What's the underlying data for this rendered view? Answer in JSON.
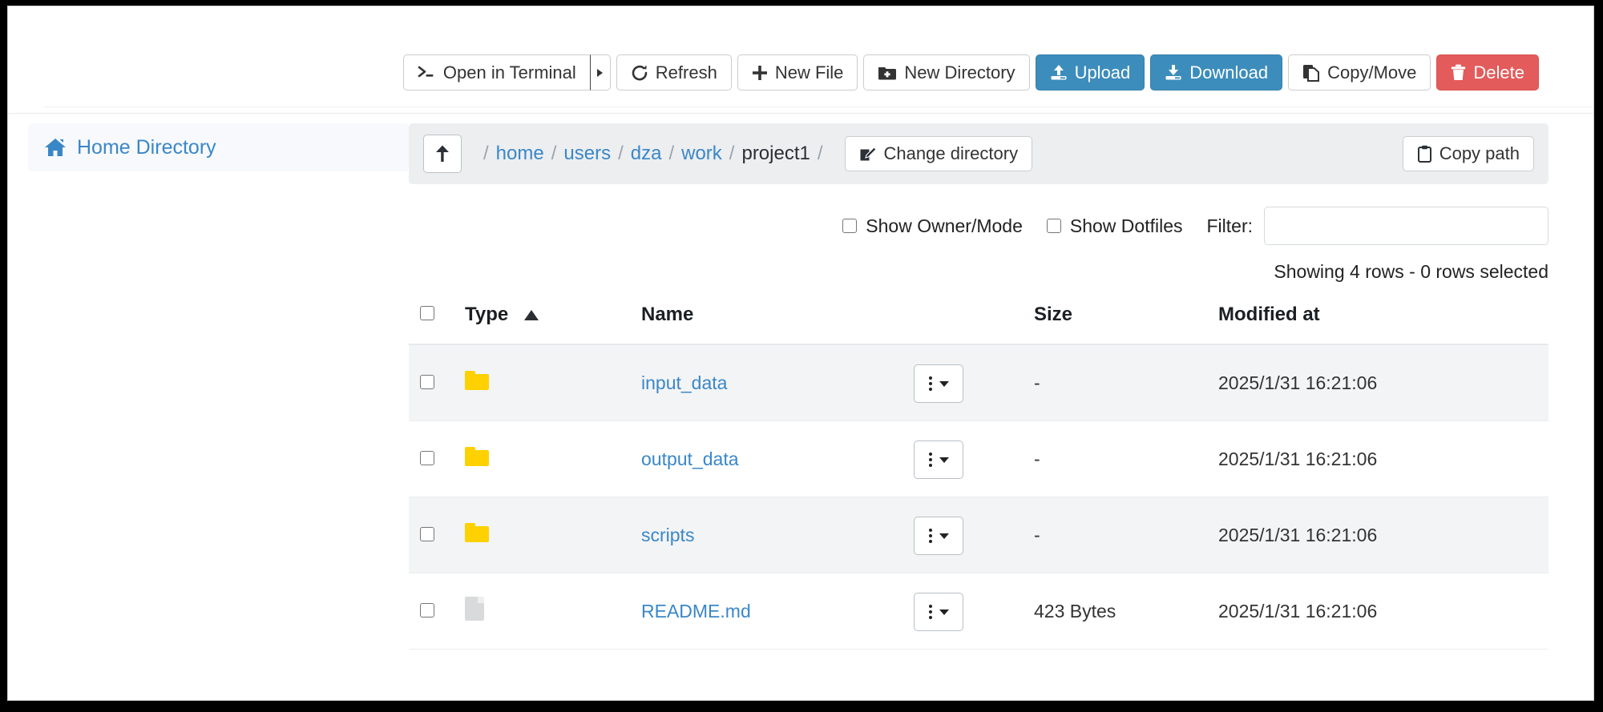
{
  "toolbar": {
    "buttons": [
      {
        "label": "Open in Terminal",
        "icon": "terminal-icon",
        "style": "default",
        "split": true
      },
      {
        "label": "Refresh",
        "icon": "refresh-icon",
        "style": "default"
      },
      {
        "label": "New File",
        "icon": "plus-icon",
        "style": "default"
      },
      {
        "label": "New Directory",
        "icon": "folder-plus-icon",
        "style": "default"
      },
      {
        "label": "Upload",
        "icon": "upload-icon",
        "style": "primary"
      },
      {
        "label": "Download",
        "icon": "download-icon",
        "style": "primary"
      },
      {
        "label": "Copy/Move",
        "icon": "copy-icon",
        "style": "default"
      },
      {
        "label": "Delete",
        "icon": "trash-icon",
        "style": "danger"
      }
    ]
  },
  "sidebar": {
    "items": [
      {
        "label": "Home Directory",
        "icon": "home-icon"
      }
    ]
  },
  "pathbar": {
    "up_icon": "arrow-up-icon",
    "leading_separator": "/",
    "crumbs": [
      {
        "label": "home",
        "current": false
      },
      {
        "label": "users",
        "current": false
      },
      {
        "label": "dza",
        "current": false
      },
      {
        "label": "work",
        "current": false
      },
      {
        "label": "project1",
        "current": true
      }
    ],
    "trailing_separator": "/",
    "change_directory_label": "Change directory",
    "change_directory_icon": "edit-square-icon",
    "copy_path_label": "Copy path",
    "copy_path_icon": "clipboard-icon"
  },
  "options": {
    "show_owner_mode_label": "Show Owner/Mode",
    "show_owner_mode_checked": false,
    "show_dotfiles_label": "Show Dotfiles",
    "show_dotfiles_checked": false,
    "filter_label": "Filter:",
    "filter_value": "",
    "filter_placeholder": ""
  },
  "status": {
    "text": "Showing 4 rows - 0 rows selected"
  },
  "table": {
    "columns": {
      "select": "",
      "type": "Type",
      "name": "Name",
      "actions": "",
      "size": "Size",
      "modified": "Modified at"
    },
    "sort": {
      "column": "Type",
      "direction": "asc",
      "indicator": "triangle-up-icon"
    },
    "rows": [
      {
        "selected": false,
        "icon": "folder-icon",
        "name": "input_data",
        "size": "-",
        "modified": "2025/1/31 16:21:06",
        "actions_icon": "kebab-menu-icon"
      },
      {
        "selected": false,
        "icon": "folder-icon",
        "name": "output_data",
        "size": "-",
        "modified": "2025/1/31 16:21:06",
        "actions_icon": "kebab-menu-icon"
      },
      {
        "selected": false,
        "icon": "folder-icon",
        "name": "scripts",
        "size": "-",
        "modified": "2025/1/31 16:21:06",
        "actions_icon": "kebab-menu-icon"
      },
      {
        "selected": false,
        "icon": "file-icon",
        "name": "README.md",
        "size": "423 Bytes",
        "modified": "2025/1/31 16:21:06",
        "actions_icon": "kebab-menu-icon"
      }
    ]
  },
  "colors": {
    "primary": "#3c8dbc",
    "danger": "#e35b5b",
    "link": "#3a87c8",
    "folder": "#ffd100",
    "file": "#d8dadc",
    "panel": "#eceef0",
    "row_stripe": "#f3f4f5"
  }
}
